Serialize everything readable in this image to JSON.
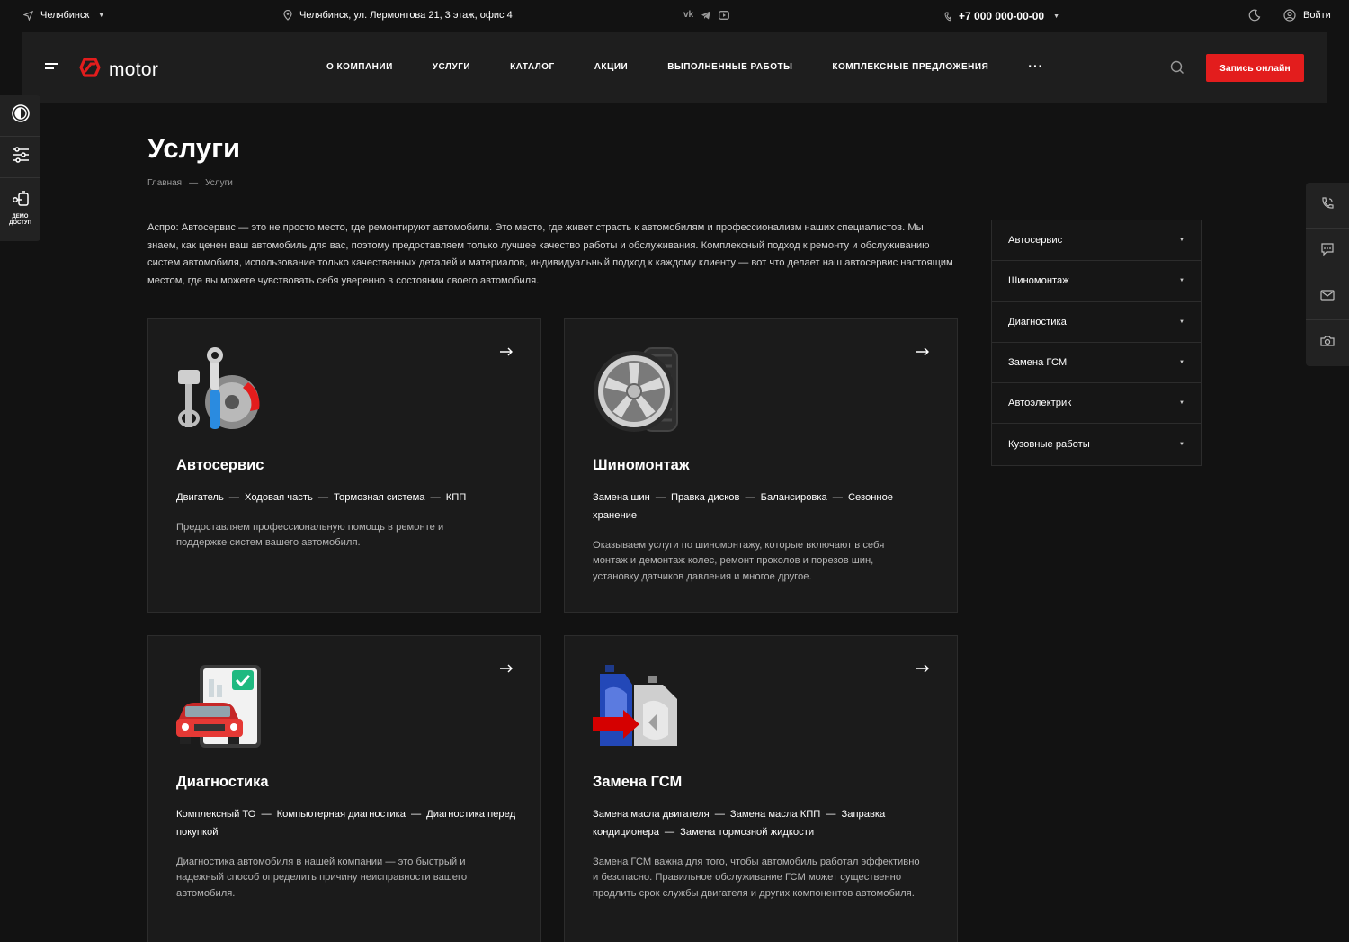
{
  "topbar": {
    "city": "Челябинск",
    "address": "Челябинск, ул. Лермонтова 21, 3 этаж, офис 4",
    "social": [
      "vk-icon",
      "telegram-icon",
      "youtube-icon"
    ],
    "phone": "+7 000 000-00-00",
    "login": "Войти"
  },
  "header": {
    "logo_text": "motor",
    "nav": [
      "О компании",
      "Услуги",
      "Каталог",
      "Акции",
      "Выполненные работы",
      "Комплексные предложения"
    ],
    "nav_more": "···",
    "cta": "Запись онлайн"
  },
  "left_panel": {
    "demo_label_1": "ДЕМО",
    "demo_label_2": "ДОСТУП"
  },
  "page": {
    "title": "Услуги",
    "breadcrumb": [
      "Главная",
      "Услуги"
    ],
    "breadcrumb_sep": "—",
    "intro": "Аспро: Автосервис — это не просто место, где ремонтируют автомобили. Это место, где живет страсть к автомобилям и профессионализм наших специалистов. Мы знаем, как ценен ваш автомобиль для вас, поэтому предоставляем только лучшее качество работы и обслуживания. Комплексный подход к ремонту и обслуживанию систем автомобиля, использование только качественных деталей и материалов, индивидуальный подход к каждому клиенту — вот что делает наш автосервис настоящим местом, где вы можете чувствовать себя уверенно в состоянии своего автомобиля."
  },
  "cards": [
    {
      "title": "Автосервис",
      "tags": [
        "Двигатель",
        "Ходовая часть",
        "Тормозная система",
        "КПП"
      ],
      "desc": "Предоставляем профессиональную помощь в ремонте и поддержке систем вашего автомобиля."
    },
    {
      "title": "Шиномонтаж",
      "tags": [
        "Замена шин",
        "Правка дисков",
        "Балансировка",
        "Сезонное хранение"
      ],
      "desc": "Оказываем услуги по шиномонтажу, которые включают в себя монтаж и демонтаж колес, ремонт проколов и порезов шин, установку датчиков давления и многое другое."
    },
    {
      "title": "Диагностика",
      "tags": [
        "Комплексный ТО",
        "Компьютерная диагностика",
        "Диагностика перед покупкой"
      ],
      "desc": "Диагностика автомобиля в нашей компании — это быстрый и надежный способ определить причину неисправности вашего автомобиля."
    },
    {
      "title": "Замена ГСМ",
      "tags": [
        "Замена масла двигателя",
        "Замена масла КПП",
        "Заправка кондиционера",
        "Замена тормозной жидкости"
      ],
      "desc": "Замена ГСМ важна для того, чтобы автомобиль работал эффективно и безопасно. Правильное обслуживание ГСМ может существенно продлить срок службы двигателя и других компонентов автомобиля."
    }
  ],
  "side_menu": [
    "Автосервис",
    "Шиномонтаж",
    "Диагностика",
    "Замена ГСМ",
    "Автоэлектрик",
    "Кузовные работы"
  ],
  "colors": {
    "accent": "#e31d1d",
    "bg": "#121212",
    "card": "#1b1b1b"
  }
}
